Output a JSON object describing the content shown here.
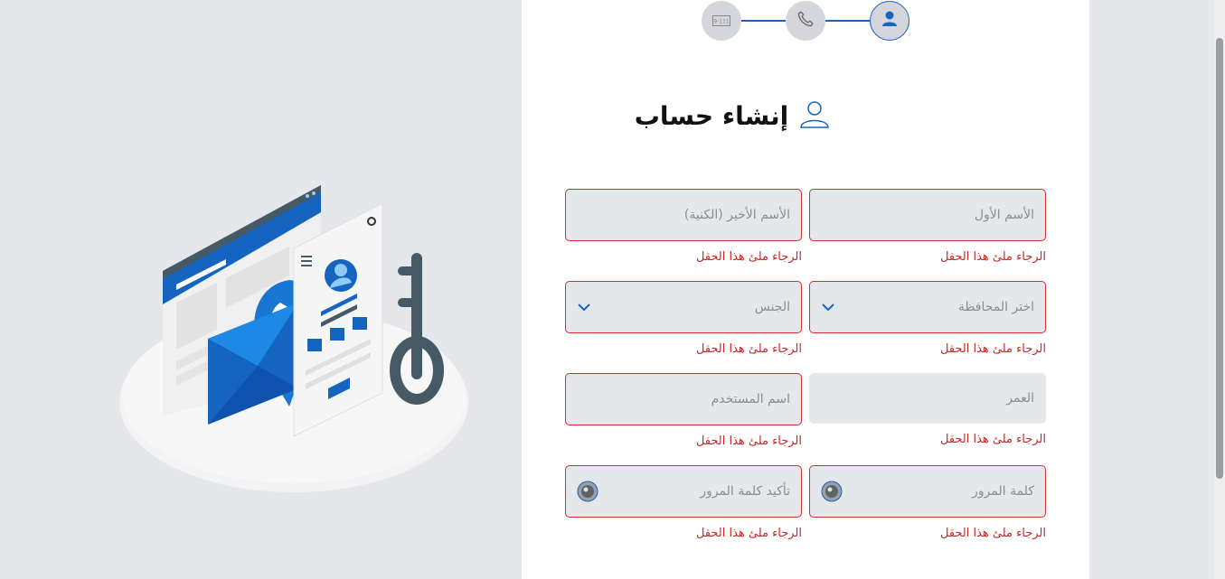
{
  "stepper": {
    "steps": [
      {
        "icon": "id-card-icon",
        "state": "pending"
      },
      {
        "icon": "phone-icon",
        "state": "pending"
      },
      {
        "icon": "user-icon",
        "state": "active"
      }
    ]
  },
  "heading": {
    "title": "إنشاء حساب",
    "icon": "user-outline-icon"
  },
  "form": {
    "first_name": {
      "placeholder": "الأسم الأول",
      "error": "الرجاء ملئ هذا الحقل"
    },
    "last_name": {
      "placeholder": "الأسم الأخير (الكنية)",
      "error": "الرجاء ملئ هذا الحقل"
    },
    "governorate": {
      "placeholder": "اختر المحافظة",
      "error": "الرجاء ملئ هذا الحقل"
    },
    "gender": {
      "placeholder": "الجنس",
      "error": "الرجاء ملئ هذا الحقل"
    },
    "age": {
      "placeholder": "العمر",
      "error": "الرجاء ملئ هذا الحقل"
    },
    "username": {
      "placeholder": "اسم المستخدم",
      "error": "الرجاء ملئ هذا الحقل"
    },
    "password": {
      "placeholder": "كلمة المرور",
      "error": "الرجاء ملئ هذا الحقل"
    },
    "confirm_password": {
      "placeholder": "تأكيد كلمة المرور",
      "error": "الرجاء ملئ هذا الحقل"
    }
  },
  "colors": {
    "accent": "#1565c0",
    "error": "#d32f2f",
    "field_bg": "#e6e7eb",
    "page_bg": "#e6e7eb"
  }
}
